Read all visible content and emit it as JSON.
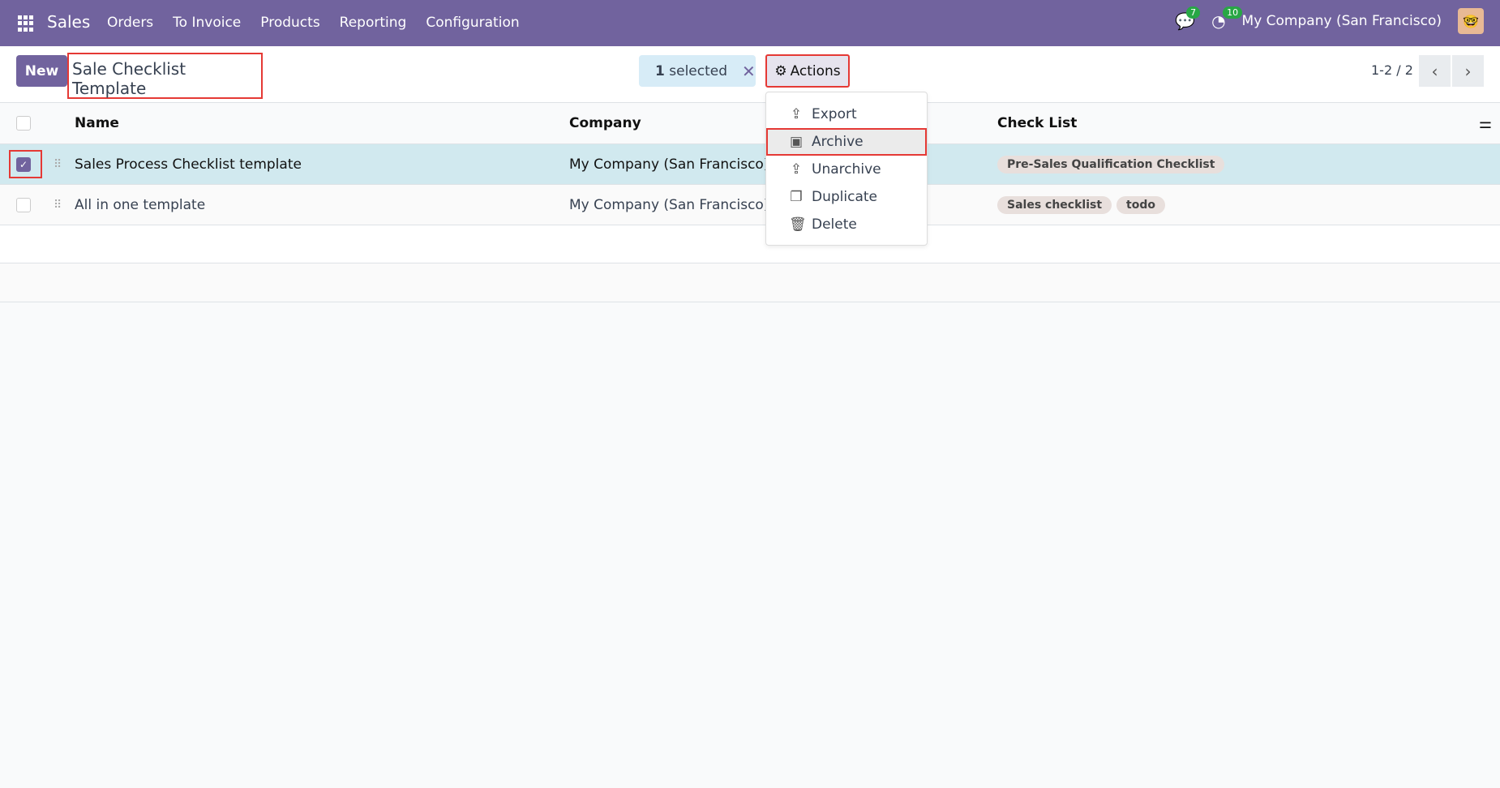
{
  "navbar": {
    "app": "Sales",
    "menu": [
      "Orders",
      "To Invoice",
      "Products",
      "Reporting",
      "Configuration"
    ],
    "messages_count": "7",
    "activities_count": "10",
    "company": "My Company (San Francisco)"
  },
  "control_panel": {
    "new_label": "New",
    "title": "Sale Checklist Template",
    "selected_count": "1",
    "selected_label": "selected",
    "actions_label": "Actions",
    "pager": "1-2 / 2"
  },
  "table": {
    "headers": [
      "Name",
      "Company",
      "Check List"
    ],
    "rows": [
      {
        "name": "Sales Process Checklist template",
        "company": "My Company (San Francisco)",
        "tags": [
          "Pre-Sales Qualification Checklist"
        ],
        "selected": true
      },
      {
        "name": "All in one template",
        "company": "My Company (San Francisco)",
        "tags": [
          "Sales checklist",
          "todo"
        ],
        "selected": false
      }
    ]
  },
  "actions_menu": [
    "Export",
    "Archive",
    "Unarchive",
    "Duplicate",
    "Delete"
  ],
  "colors": {
    "brand": "#71639e",
    "highlight": "#e53935",
    "selected_row": "#d1e9ef"
  }
}
